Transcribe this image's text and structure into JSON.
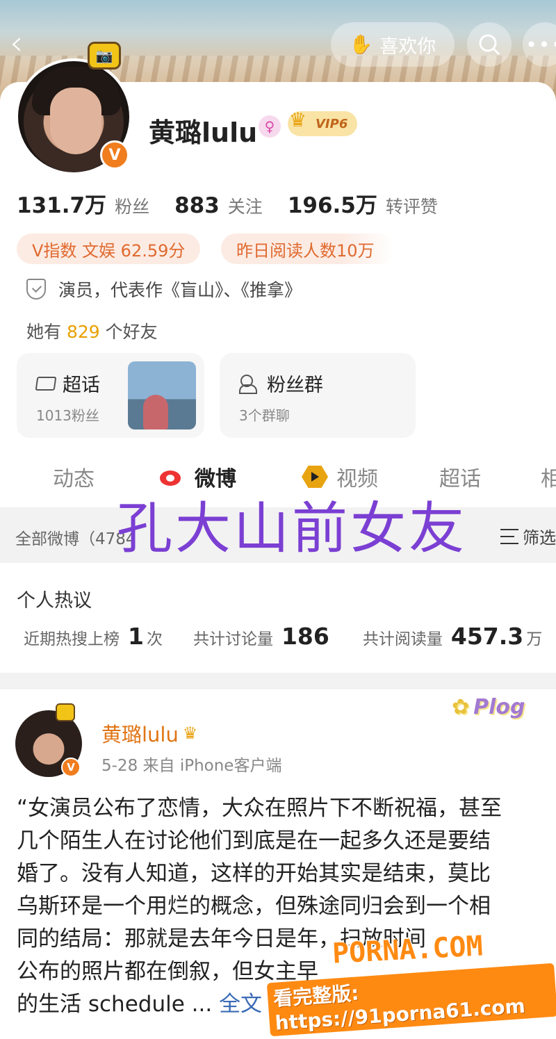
{
  "header": {
    "back_icon": "chevron-left-icon",
    "like_button_label": "喜欢你",
    "like_icon": "hand-heart-icon",
    "search_icon": "search-icon",
    "more_icon": "more-horizontal-icon"
  },
  "profile": {
    "name": "黄璐lulu",
    "verified_badge": "V",
    "gender_icon": "female-icon",
    "vip_label": "VIP6",
    "stats": [
      {
        "value": "131.7万",
        "label": "粉丝"
      },
      {
        "value": "883",
        "label": "关注"
      },
      {
        "value": "196.5万",
        "label": "转评赞"
      }
    ],
    "tags": [
      "V指数 文娱 62.59分",
      "昨日阅读人数10万"
    ],
    "bio": "演员，代表作《盲山》、《推拿》",
    "friends_prefix": "她有",
    "friends_count": "829",
    "friends_suffix": "个好友"
  },
  "cards": [
    {
      "title": "超话",
      "subtitle": "1013粉丝",
      "icon": "diamond-icon"
    },
    {
      "title": "粉丝群",
      "subtitle": "3个群聊",
      "icon": "people-icon"
    }
  ],
  "tabs": [
    "动态",
    "微博",
    "视频",
    "超话",
    "相"
  ],
  "active_tab": "微博",
  "filter": {
    "all_label": "全部微博（4784",
    "filter_label": "筛选"
  },
  "overlay_caption": "孔大山前女友",
  "hot": {
    "title": "个人热议",
    "items": [
      {
        "label": "近期热搜上榜",
        "value": "1",
        "unit": "次"
      },
      {
        "label": "共计讨论量",
        "value": "186",
        "unit": ""
      },
      {
        "label": "共计阅读量",
        "value": "457.3",
        "unit": "万"
      }
    ]
  },
  "post": {
    "author": "黄璐lulu",
    "meta": "5-28  来自 iPhone客户端",
    "sticker_text": "Plog",
    "body": "“女演员公布了恋情，大众在照片下不断祝福，甚至\n几个陌生人在讨论他们到底是在一起多久还是要结\n婚了。没有人知道，这样的开始其实是结束，莫比\n乌斯环是一个用烂的概念，但殊途同归会到一个相\n同的结局：那就是去年今日是年，扫放时间\n公布的照片都在倒叙，但女主早\n的生活 schedule ...",
    "more_label": "全文"
  },
  "watermark": {
    "site": "PORNA.COM",
    "url_line": "看完整版: https://91porna61.com"
  },
  "colors": {
    "accent_orange": "#f07d1e",
    "caption_purple": "#7b3fd3",
    "link_blue": "#3a6bb5"
  }
}
